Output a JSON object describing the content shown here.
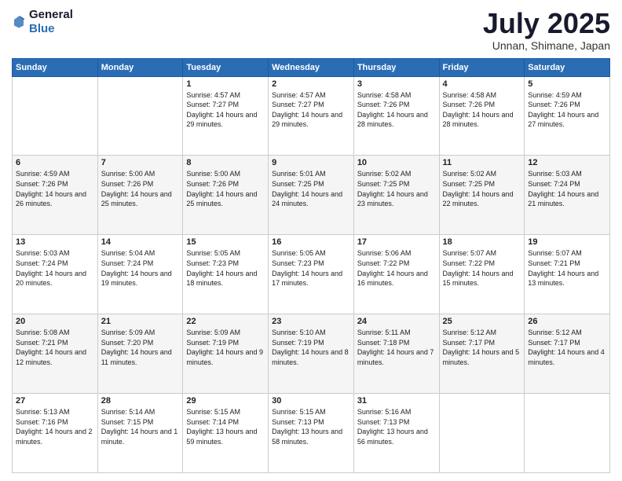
{
  "logo": {
    "general": "General",
    "blue": "Blue"
  },
  "header": {
    "month": "July 2025",
    "location": "Unnan, Shimane, Japan"
  },
  "days_of_week": [
    "Sunday",
    "Monday",
    "Tuesday",
    "Wednesday",
    "Thursday",
    "Friday",
    "Saturday"
  ],
  "weeks": [
    [
      {
        "day": "",
        "info": ""
      },
      {
        "day": "",
        "info": ""
      },
      {
        "day": "1",
        "info": "Sunrise: 4:57 AM\nSunset: 7:27 PM\nDaylight: 14 hours and 29 minutes."
      },
      {
        "day": "2",
        "info": "Sunrise: 4:57 AM\nSunset: 7:27 PM\nDaylight: 14 hours and 29 minutes."
      },
      {
        "day": "3",
        "info": "Sunrise: 4:58 AM\nSunset: 7:26 PM\nDaylight: 14 hours and 28 minutes."
      },
      {
        "day": "4",
        "info": "Sunrise: 4:58 AM\nSunset: 7:26 PM\nDaylight: 14 hours and 28 minutes."
      },
      {
        "day": "5",
        "info": "Sunrise: 4:59 AM\nSunset: 7:26 PM\nDaylight: 14 hours and 27 minutes."
      }
    ],
    [
      {
        "day": "6",
        "info": "Sunrise: 4:59 AM\nSunset: 7:26 PM\nDaylight: 14 hours and 26 minutes."
      },
      {
        "day": "7",
        "info": "Sunrise: 5:00 AM\nSunset: 7:26 PM\nDaylight: 14 hours and 25 minutes."
      },
      {
        "day": "8",
        "info": "Sunrise: 5:00 AM\nSunset: 7:26 PM\nDaylight: 14 hours and 25 minutes."
      },
      {
        "day": "9",
        "info": "Sunrise: 5:01 AM\nSunset: 7:25 PM\nDaylight: 14 hours and 24 minutes."
      },
      {
        "day": "10",
        "info": "Sunrise: 5:02 AM\nSunset: 7:25 PM\nDaylight: 14 hours and 23 minutes."
      },
      {
        "day": "11",
        "info": "Sunrise: 5:02 AM\nSunset: 7:25 PM\nDaylight: 14 hours and 22 minutes."
      },
      {
        "day": "12",
        "info": "Sunrise: 5:03 AM\nSunset: 7:24 PM\nDaylight: 14 hours and 21 minutes."
      }
    ],
    [
      {
        "day": "13",
        "info": "Sunrise: 5:03 AM\nSunset: 7:24 PM\nDaylight: 14 hours and 20 minutes."
      },
      {
        "day": "14",
        "info": "Sunrise: 5:04 AM\nSunset: 7:24 PM\nDaylight: 14 hours and 19 minutes."
      },
      {
        "day": "15",
        "info": "Sunrise: 5:05 AM\nSunset: 7:23 PM\nDaylight: 14 hours and 18 minutes."
      },
      {
        "day": "16",
        "info": "Sunrise: 5:05 AM\nSunset: 7:23 PM\nDaylight: 14 hours and 17 minutes."
      },
      {
        "day": "17",
        "info": "Sunrise: 5:06 AM\nSunset: 7:22 PM\nDaylight: 14 hours and 16 minutes."
      },
      {
        "day": "18",
        "info": "Sunrise: 5:07 AM\nSunset: 7:22 PM\nDaylight: 14 hours and 15 minutes."
      },
      {
        "day": "19",
        "info": "Sunrise: 5:07 AM\nSunset: 7:21 PM\nDaylight: 14 hours and 13 minutes."
      }
    ],
    [
      {
        "day": "20",
        "info": "Sunrise: 5:08 AM\nSunset: 7:21 PM\nDaylight: 14 hours and 12 minutes."
      },
      {
        "day": "21",
        "info": "Sunrise: 5:09 AM\nSunset: 7:20 PM\nDaylight: 14 hours and 11 minutes."
      },
      {
        "day": "22",
        "info": "Sunrise: 5:09 AM\nSunset: 7:19 PM\nDaylight: 14 hours and 9 minutes."
      },
      {
        "day": "23",
        "info": "Sunrise: 5:10 AM\nSunset: 7:19 PM\nDaylight: 14 hours and 8 minutes."
      },
      {
        "day": "24",
        "info": "Sunrise: 5:11 AM\nSunset: 7:18 PM\nDaylight: 14 hours and 7 minutes."
      },
      {
        "day": "25",
        "info": "Sunrise: 5:12 AM\nSunset: 7:17 PM\nDaylight: 14 hours and 5 minutes."
      },
      {
        "day": "26",
        "info": "Sunrise: 5:12 AM\nSunset: 7:17 PM\nDaylight: 14 hours and 4 minutes."
      }
    ],
    [
      {
        "day": "27",
        "info": "Sunrise: 5:13 AM\nSunset: 7:16 PM\nDaylight: 14 hours and 2 minutes."
      },
      {
        "day": "28",
        "info": "Sunrise: 5:14 AM\nSunset: 7:15 PM\nDaylight: 14 hours and 1 minute."
      },
      {
        "day": "29",
        "info": "Sunrise: 5:15 AM\nSunset: 7:14 PM\nDaylight: 13 hours and 59 minutes."
      },
      {
        "day": "30",
        "info": "Sunrise: 5:15 AM\nSunset: 7:13 PM\nDaylight: 13 hours and 58 minutes."
      },
      {
        "day": "31",
        "info": "Sunrise: 5:16 AM\nSunset: 7:13 PM\nDaylight: 13 hours and 56 minutes."
      },
      {
        "day": "",
        "info": ""
      },
      {
        "day": "",
        "info": ""
      }
    ]
  ]
}
